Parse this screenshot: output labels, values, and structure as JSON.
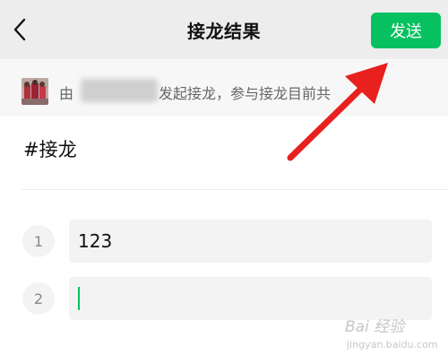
{
  "header": {
    "title": "接龙结果",
    "send_label": "发送",
    "back_icon": "chevron-left-icon"
  },
  "info": {
    "prefix": "由",
    "text": "发起接龙，参与接龙目前共",
    "avatar_icon": "user-avatar"
  },
  "topic": "#接龙",
  "entries": [
    {
      "number": "1",
      "value": "123"
    },
    {
      "number": "2",
      "value": ""
    }
  ],
  "watermark": {
    "main": "Bai 经验",
    "sub": "jingyan.baidu.com"
  },
  "colors": {
    "accent": "#07c160",
    "arrow": "#e8201e",
    "topbar": "#ededed"
  }
}
